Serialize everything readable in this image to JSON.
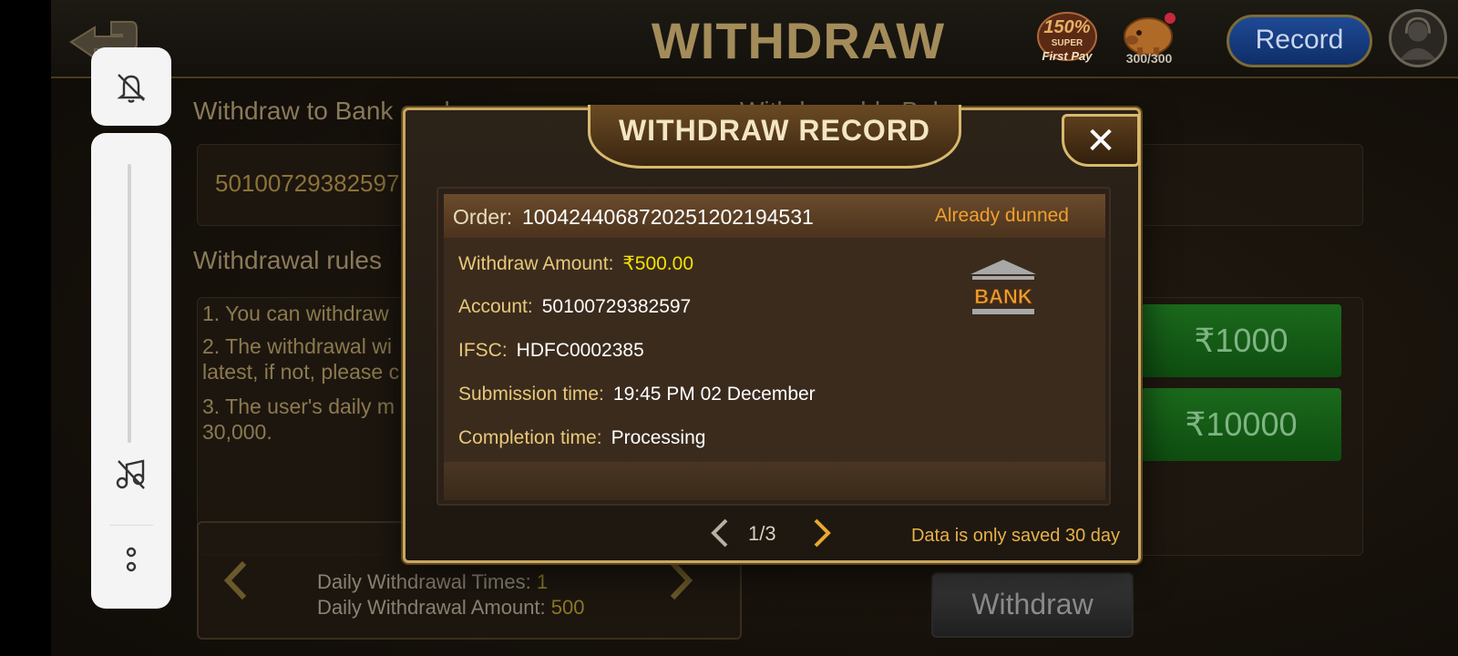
{
  "header": {
    "title": "WITHDRAW",
    "promo_percent": "150%",
    "promo_line1": "SUPER",
    "promo_line2": "First Pay",
    "piggy_count": "300/300",
    "record_label": "Record"
  },
  "background": {
    "bank_section_label": "Withdraw to Bank card",
    "balance_label": "Withdrawable Balance",
    "bank_account": "50100729382597",
    "rules_title": "Withdrawal rules",
    "rules": [
      "1. You can withdraw",
      "2. The withdrawal wi",
      "latest, if not, please c",
      "3. The user's daily m",
      "30,000."
    ],
    "amount_buttons": [
      "₹1000",
      "₹10000"
    ],
    "daily_times_label": "Daily Withdrawal Times:",
    "daily_times_value": "1",
    "daily_amount_label": "Daily Withdrawal Amount:",
    "daily_amount_value": "500",
    "withdraw_button": "Withdraw"
  },
  "modal": {
    "title": "WITHDRAW RECORD",
    "close_symbol": "✕",
    "record": {
      "order_label": "Order:",
      "order_number": "100424406872025120219453​1",
      "status": "Already dunned",
      "amount_label": "Withdraw Amount:",
      "amount_value": "₹500.00",
      "account_label": "Account:",
      "account_value": "50100729382597",
      "ifsc_label": "IFSC:",
      "ifsc_value": "HDFC0002385",
      "submission_label": "Submission time:",
      "submission_value": "19:45 PM 02 December",
      "completion_label": "Completion time:",
      "completion_value": "Processing",
      "bank_icon_text": "BANK"
    },
    "pager": "1/3",
    "note": "Data is only saved 30 day"
  },
  "icons": {
    "mute": "bell-off-icon",
    "music": "music-off-icon",
    "more": "more-vertical-icon"
  },
  "colors": {
    "accent_gold": "#c9a85e",
    "status_orange": "#f0a030",
    "amount_yellow": "#f4e200",
    "amount_button_green": "#1b6a1c",
    "record_button_blue": "#1e4a95"
  }
}
